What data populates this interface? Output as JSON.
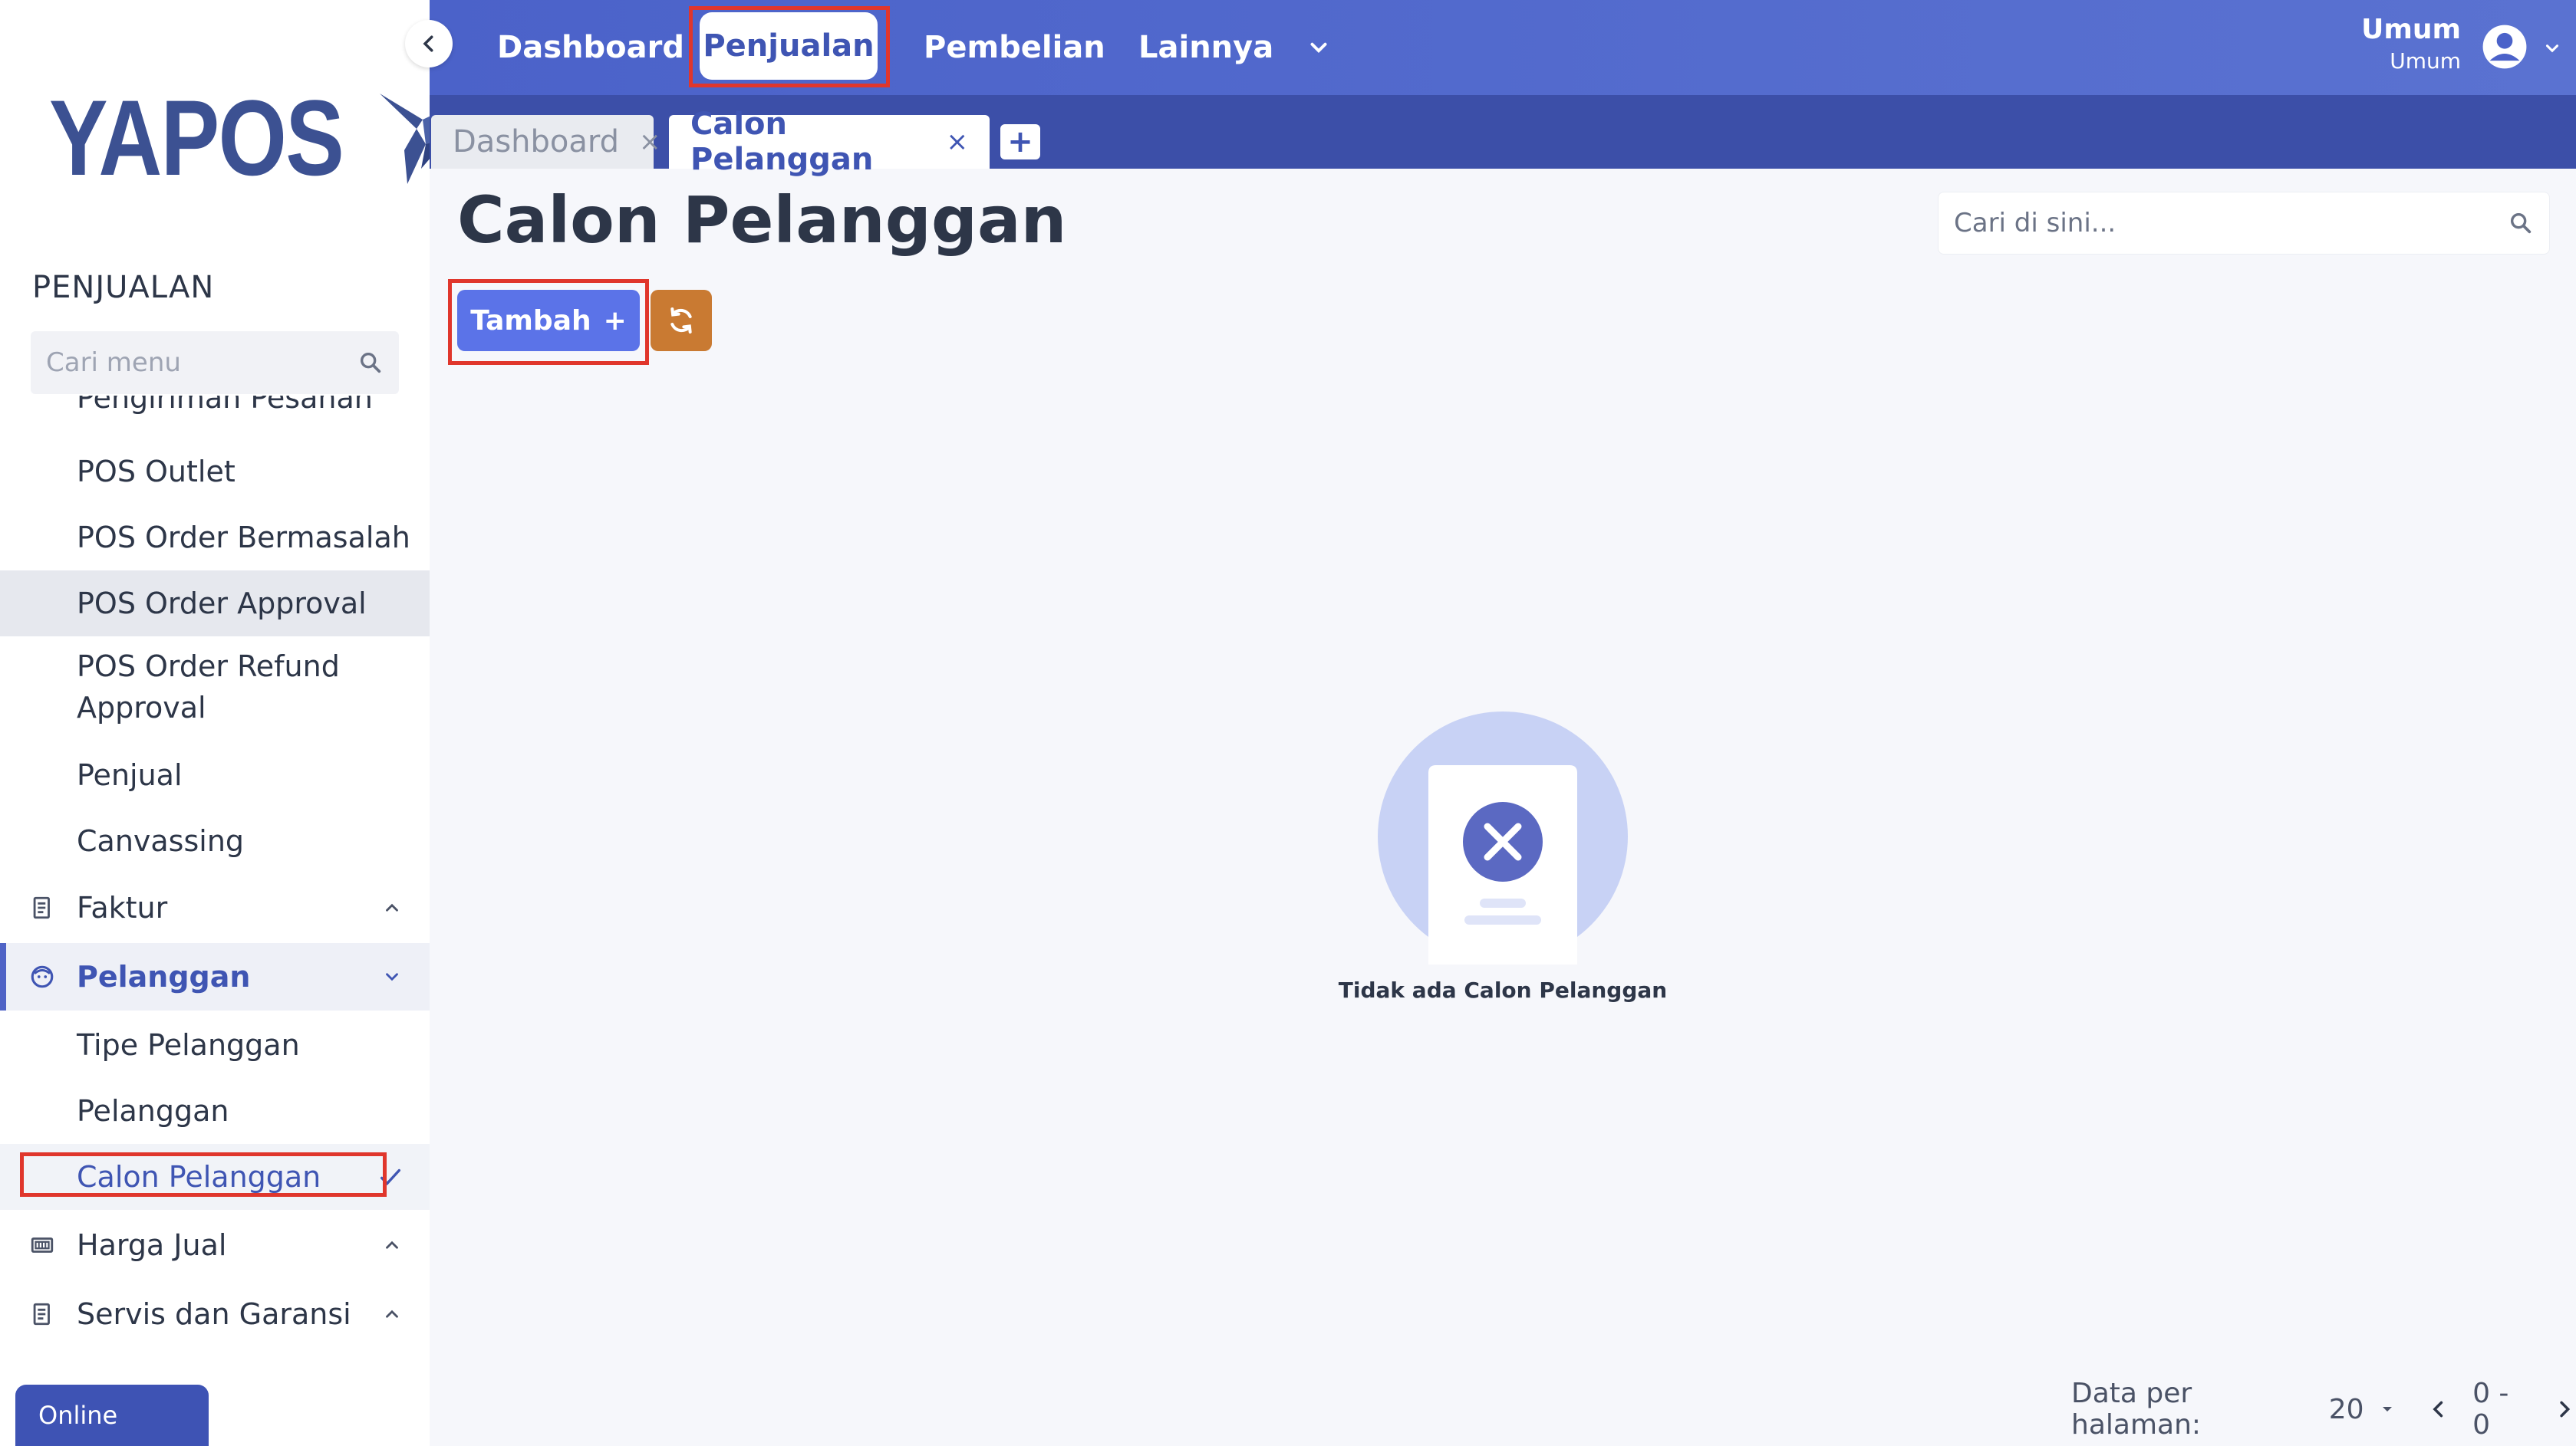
{
  "sidebar": {
    "logo_text": "YAPOS",
    "section_title": "PENJUALAN",
    "search_placeholder": "Cari menu",
    "items": [
      {
        "label": "Pengiriman Pesanan"
      },
      {
        "label": "POS Outlet"
      },
      {
        "label": "POS Order Bermasalah"
      },
      {
        "label": "POS Order Approval"
      },
      {
        "label": "POS Order Refund Approval"
      },
      {
        "label": "Penjual"
      },
      {
        "label": "Canvassing"
      },
      {
        "label": "Faktur"
      },
      {
        "label": "Pelanggan"
      },
      {
        "label": "Tipe Pelanggan"
      },
      {
        "label": "Pelanggan"
      },
      {
        "label": "Calon Pelanggan"
      },
      {
        "label": "Harga Jual"
      },
      {
        "label": "Servis dan Garansi"
      }
    ],
    "status": "Online"
  },
  "topnav": {
    "items": [
      {
        "label": "Dashboard"
      },
      {
        "label": "Penjualan"
      },
      {
        "label": "Pembelian"
      },
      {
        "label": "Lainnya"
      }
    ],
    "user_name": "Umum",
    "user_role": "Umum"
  },
  "tabs": [
    {
      "label": "Dashboard",
      "close": "×"
    },
    {
      "label": "Calon Pelanggan",
      "close": "×"
    }
  ],
  "tab_add": "+",
  "main": {
    "title": "Calon Pelanggan",
    "search_placeholder": "Cari di sini...",
    "add_button": "Tambah",
    "add_symbol": "+",
    "empty_text": "Tidak ada Calon Pelanggan"
  },
  "pagination": {
    "label": "Data per halaman:",
    "per_page": "20",
    "range": "0 - 0"
  },
  "colors": {
    "primary": "#4b62c9",
    "tab_bar": "#3c4fa8",
    "add_button": "#5b73e8",
    "refresh_button": "#c97a32",
    "highlight_box": "#e0362c"
  }
}
